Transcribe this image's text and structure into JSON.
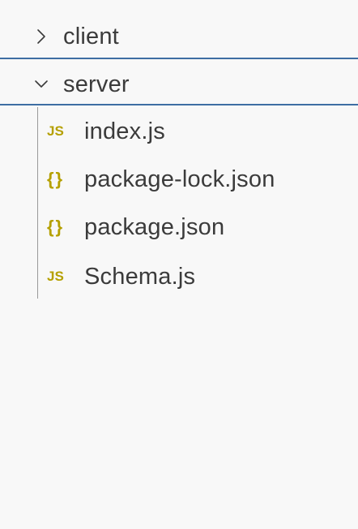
{
  "explorer": {
    "folders": {
      "client": {
        "label": "client",
        "state": "collapsed",
        "icon": "chevron-right-icon"
      },
      "server": {
        "label": "server",
        "state": "expanded",
        "icon": "chevron-down-icon"
      }
    },
    "files": [
      {
        "label": "index.js",
        "type": "js",
        "icon_text": "JS"
      },
      {
        "label": "package-lock.json",
        "type": "json",
        "icon_text": "{}"
      },
      {
        "label": "package.json",
        "type": "json",
        "icon_text": "{}"
      },
      {
        "label": "Schema.js",
        "type": "js",
        "icon_text": "JS"
      }
    ]
  },
  "colors": {
    "background": "#f8f8f8",
    "separator": "#3e6ea3",
    "file_icon": "#b5a000",
    "text": "#3b3b3b",
    "indent_guide": "#9a9a9a"
  }
}
